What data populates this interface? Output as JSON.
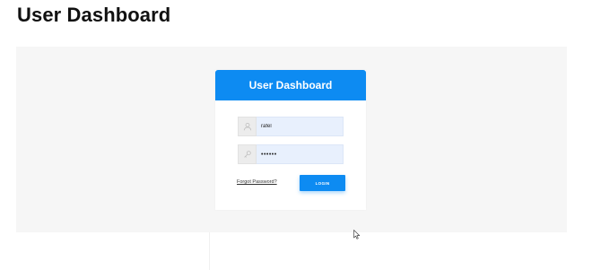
{
  "page": {
    "title": "User Dashboard"
  },
  "login_card": {
    "title": "User Dashboard",
    "username": {
      "value": "rafel",
      "icon": "user-icon"
    },
    "password": {
      "value": "••••••",
      "icon": "key-icon"
    },
    "forgot_password_label": "Forgot Password?",
    "login_label": "LOGIN"
  },
  "colors": {
    "accent": "#0d8bf2",
    "panel_background": "#f6f6f6",
    "input_background": "#e8f0fd"
  }
}
